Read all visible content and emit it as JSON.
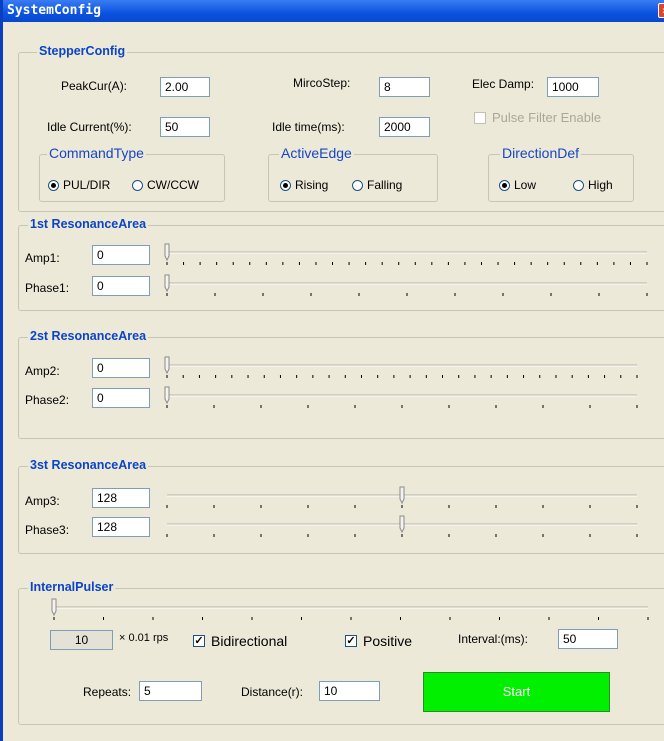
{
  "window": {
    "title": "SystemConfig",
    "close_glyph": "×"
  },
  "stepper": {
    "title": "StepperConfig",
    "peak_label": "PeakCur(A):",
    "peak_value": "2.00",
    "micro_label": "MircoStep:",
    "micro_value": "8",
    "damp_label": "Elec Damp:",
    "damp_value": "1000",
    "idle_cur_label": "Idle Current(%):",
    "idle_cur_value": "50",
    "idle_time_label": "Idle time(ms):",
    "idle_time_value": "2000",
    "pulse_filter_label": "Pulse Filter Enable",
    "pulse_filter_checked": false,
    "command_type": {
      "title": "CommandType",
      "opt1": "PUL/DIR",
      "opt2": "CW/CCW",
      "selected": "PUL/DIR"
    },
    "active_edge": {
      "title": "ActiveEdge",
      "opt1": "Rising",
      "opt2": "Falling",
      "selected": "Rising"
    },
    "direction": {
      "title": "DirectionDef",
      "opt1": "Low",
      "opt2": "High",
      "selected": "Low"
    }
  },
  "res1": {
    "title": "1st ResonanceArea",
    "amp_label": "Amp1:",
    "amp_value": "0",
    "phase_label": "Phase1:",
    "phase_value": "0",
    "amp_level": 0,
    "phase_level": 0
  },
  "res2": {
    "title": "2st ResonanceArea",
    "amp_label": "Amp2:",
    "amp_value": "0",
    "phase_label": "Phase2:",
    "phase_value": "0",
    "amp_level": 0,
    "phase_level": 0
  },
  "res3": {
    "title": "3st ResonanceArea",
    "amp_label": "Amp3:",
    "amp_value": "128",
    "phase_label": "Phase3:",
    "phase_value": "128",
    "amp_level": 0.5,
    "phase_level": 0.5
  },
  "pulser": {
    "title": "InternalPulser",
    "speed_value": "10",
    "speed_unit": "× 0.01 rps",
    "speed_level": 0,
    "bidirectional_label": "Bidirectional",
    "bidirectional_checked": true,
    "positive_label": "Positive",
    "positive_checked": true,
    "interval_label": "Interval:(ms):",
    "interval_value": "50",
    "repeats_label": "Repeats:",
    "repeats_value": "5",
    "distance_label": "Distance(r):",
    "distance_value": "10",
    "start_label": "Start",
    "start_color": "#00f000"
  }
}
